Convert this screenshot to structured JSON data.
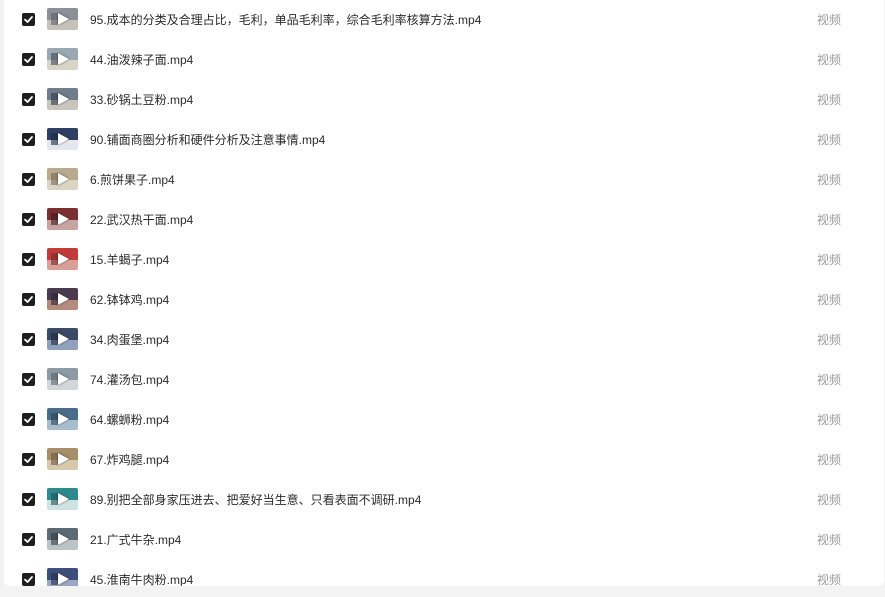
{
  "files": [
    {
      "name": "95.成本的分类及合理占比，毛利，单品毛利率，综合毛利率核算方法.mp4",
      "type": "视频",
      "checked": true,
      "thumb": [
        "#8a8f98",
        "#c7c2b8",
        "#5b5f66"
      ]
    },
    {
      "name": "44.油泼辣子面.mp4",
      "type": "视频",
      "checked": true,
      "thumb": [
        "#9aa8b3",
        "#d9d4c8",
        "#3f4a55"
      ]
    },
    {
      "name": "33.砂锅土豆粉.mp4",
      "type": "视频",
      "checked": true,
      "thumb": [
        "#6f7d8c",
        "#c9c5bd",
        "#2e3a48"
      ]
    },
    {
      "name": "90.铺面商圈分析和硬件分析及注意事情.mp4",
      "type": "视频",
      "checked": true,
      "thumb": [
        "#2f3e63",
        "#e5e7ef",
        "#1d2a48"
      ]
    },
    {
      "name": "6.煎饼果子.mp4",
      "type": "视频",
      "checked": true,
      "thumb": [
        "#b9a98f",
        "#dcd4c2",
        "#7a6b55"
      ]
    },
    {
      "name": "22.武汉热干面.mp4",
      "type": "视频",
      "checked": true,
      "thumb": [
        "#7c2f2f",
        "#c9a3a0",
        "#3b1d1d"
      ]
    },
    {
      "name": "15.羊蝎子.mp4",
      "type": "视频",
      "checked": true,
      "thumb": [
        "#c23b3b",
        "#d9a09a",
        "#7a2424"
      ]
    },
    {
      "name": "62.钵钵鸡.mp4",
      "type": "视频",
      "checked": true,
      "thumb": [
        "#4a3b4f",
        "#b58b7d",
        "#2c2430"
      ]
    },
    {
      "name": "34.肉蛋堡.mp4",
      "type": "视频",
      "checked": true,
      "thumb": [
        "#3a4a66",
        "#8fa1bd",
        "#1e2a40"
      ]
    },
    {
      "name": "74.灌汤包.mp4",
      "type": "视频",
      "checked": true,
      "thumb": [
        "#8e9aa3",
        "#d3d6d8",
        "#5a646b"
      ]
    },
    {
      "name": "64.螺蛳粉.mp4",
      "type": "视频",
      "checked": true,
      "thumb": [
        "#4a6c8a",
        "#a7bccc",
        "#2d4459"
      ]
    },
    {
      "name": "67.炸鸡腿.mp4",
      "type": "视频",
      "checked": true,
      "thumb": [
        "#a68e6a",
        "#d8c9ad",
        "#6b5a3f"
      ]
    },
    {
      "name": "89.别把全部身家压进去、把爱好当生意、只看表面不调研.mp4",
      "type": "视频",
      "checked": true,
      "thumb": [
        "#2f8a8f",
        "#cfe3e2",
        "#1d5457"
      ]
    },
    {
      "name": "21.广式牛杂.mp4",
      "type": "视频",
      "checked": true,
      "thumb": [
        "#5e6a73",
        "#bcc3c7",
        "#353d43"
      ]
    },
    {
      "name": "45.淮南牛肉粉.mp4",
      "type": "视频",
      "checked": true,
      "thumb": [
        "#3c4f7a",
        "#9aa6c4",
        "#222f4d"
      ]
    }
  ]
}
